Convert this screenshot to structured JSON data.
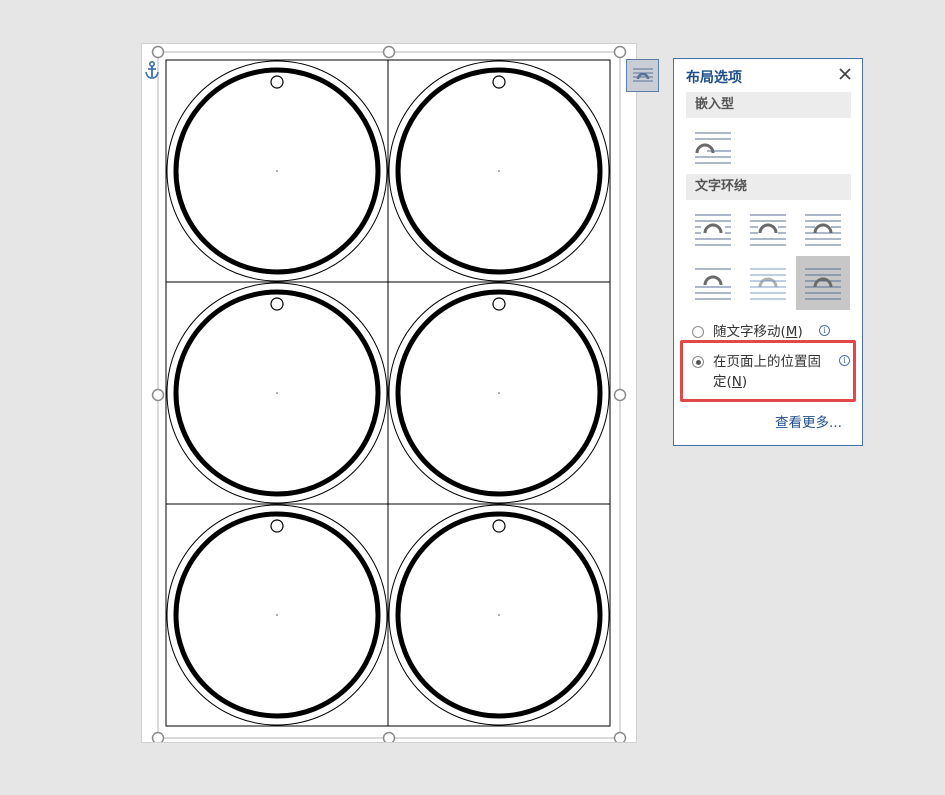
{
  "layout_panel": {
    "title": "布局选项",
    "sections": {
      "inline": "嵌入型",
      "wrap": "文字环绕"
    },
    "options": {
      "move_with_text": "随文字移动",
      "move_with_text_key": "M",
      "fix_on_page_part1": "在页面上的位置固",
      "fix_on_page_part2": "定",
      "fix_on_page_key": "N"
    },
    "selected_position": "fix_on_page",
    "selected_wrap": "in-front-of-text",
    "see_more": "查看更多...",
    "info_glyph": "i"
  },
  "document": {
    "grid_rows": 3,
    "grid_cols": 2
  },
  "colors": {
    "accent": "#1f4e8c",
    "highlight": "#e0484a",
    "selected_bg": "#c7c7c7"
  }
}
